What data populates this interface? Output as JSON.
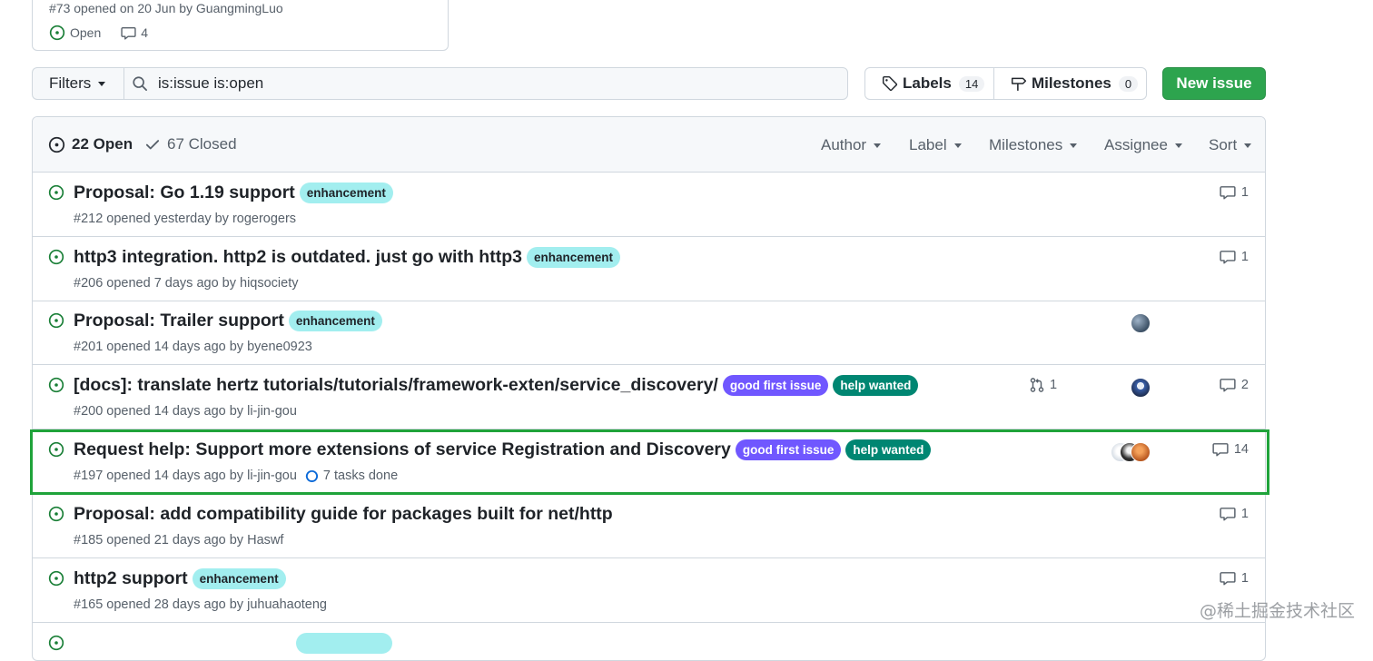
{
  "pinned": {
    "meta": "#73 opened on 20 Jun by GuangmingLuo",
    "status": "Open",
    "comments": "4"
  },
  "filter_bar": {
    "filters_label": "Filters",
    "search_value": "is:issue is:open",
    "labels_label": "Labels",
    "labels_count": "14",
    "milestones_label": "Milestones",
    "milestones_count": "0",
    "new_issue_label": "New issue"
  },
  "issues_header": {
    "open_label": "22 Open",
    "closed_label": "67 Closed",
    "filters": [
      "Author",
      "Label",
      "Milestones",
      "Assignee",
      "Sort"
    ]
  },
  "issues": [
    {
      "title": "Proposal: Go 1.19 support",
      "labels": [
        "enhancement"
      ],
      "meta_prefix": "#212 opened yesterday by",
      "author": "rogerogers",
      "comments": "1"
    },
    {
      "title": "http3 integration. http2 is outdated. just go with http3",
      "labels": [
        "enhancement"
      ],
      "meta_prefix": "#206 opened 7 days ago by",
      "author": "hiqsociety",
      "comments": "1"
    },
    {
      "title": "Proposal: Trailer support",
      "labels": [
        "enhancement"
      ],
      "meta_prefix": "#201 opened 14 days ago by",
      "author": "byene0923",
      "comments": ""
    },
    {
      "title": "[docs]: translate hertz tutorials/tutorials/framework-exten/service_discovery/",
      "labels": [
        "good first issue",
        "help wanted"
      ],
      "meta_prefix": "#200 opened 14 days ago by",
      "author": "li-jin-gou",
      "linked_prs": "1",
      "comments": "2"
    },
    {
      "title": "Request help: Support more extensions of service Registration and Discovery",
      "labels": [
        "good first issue",
        "help wanted"
      ],
      "meta_prefix": "#197 opened 14 days ago by",
      "author": "li-jin-gou",
      "tasks": "7 tasks done",
      "comments": "14"
    },
    {
      "title": "Proposal: add compatibility guide for packages built for net/http",
      "labels": [],
      "meta_prefix": "#185 opened 21 days ago by",
      "author": "Haswf",
      "comments": "1"
    },
    {
      "title": "http2 support",
      "labels": [
        "enhancement"
      ],
      "meta_prefix": "#165 opened 28 days ago by",
      "author": "juhuahaoteng",
      "comments": "1"
    }
  ],
  "colors": {
    "open_green": "#1a7f37",
    "enhancement": "#a2eeef",
    "good_first_issue": "#7057ff",
    "help_wanted": "#008672",
    "primary_button": "#2da44e",
    "highlight_border": "#1fa33a"
  },
  "watermark": "@稀土掘金技术社区"
}
